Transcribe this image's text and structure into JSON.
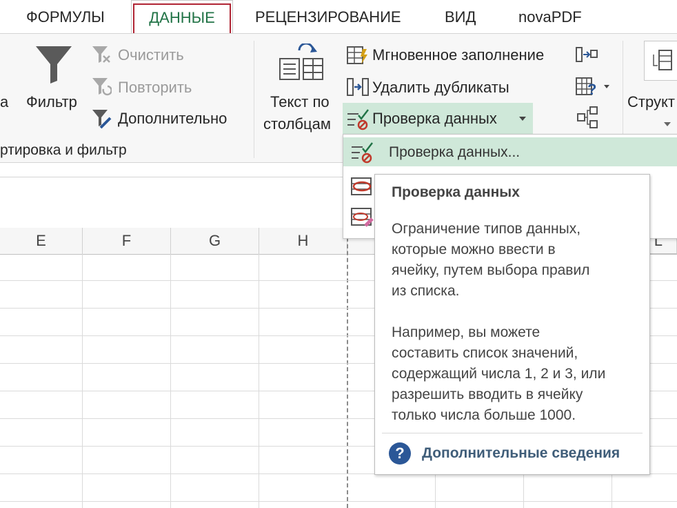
{
  "tabs": {
    "formulas": "ФОРМУЛЫ",
    "data": "ДАННЫЕ",
    "review": "РЕЦЕНЗИРОВАНИЕ",
    "view": "ВИД",
    "novapdf": "novaPDF"
  },
  "ribbon": {
    "cut_left_label": "а",
    "filter": "Фильтр",
    "clear": "Очистить",
    "reapply": "Повторить",
    "advanced": "Дополнительно",
    "sort_group": "ртировка и фильтр",
    "text_to_columns_1": "Текст по",
    "text_to_columns_2": "столбцам",
    "flash_fill": "Мгновенное заполнение",
    "remove_duplicates": "Удалить дубликаты",
    "data_validation": "Проверка данных",
    "outline": "Структ"
  },
  "columns": [
    "E",
    "F",
    "G",
    "H",
    "L"
  ],
  "dropdown": {
    "item1": "Проверка данных..."
  },
  "tooltip": {
    "title": "Проверка данных",
    "para1": [
      "Ограничение типов данных,",
      "которые можно ввести в",
      "ячейку, путем выбора правил",
      "из списка."
    ],
    "para2": [
      "Например, вы можете",
      "составить список значений,",
      "содержащий числа 1, 2 и 3, или",
      "разрешить вводить в ячейку",
      "только числа больше 1000."
    ],
    "link": "Дополнительные сведения"
  },
  "colors": {
    "accent_green": "#217346",
    "active_tab_border": "#b02433",
    "selection_bg": "#cfe8d9",
    "help_blue": "#2b5797"
  }
}
